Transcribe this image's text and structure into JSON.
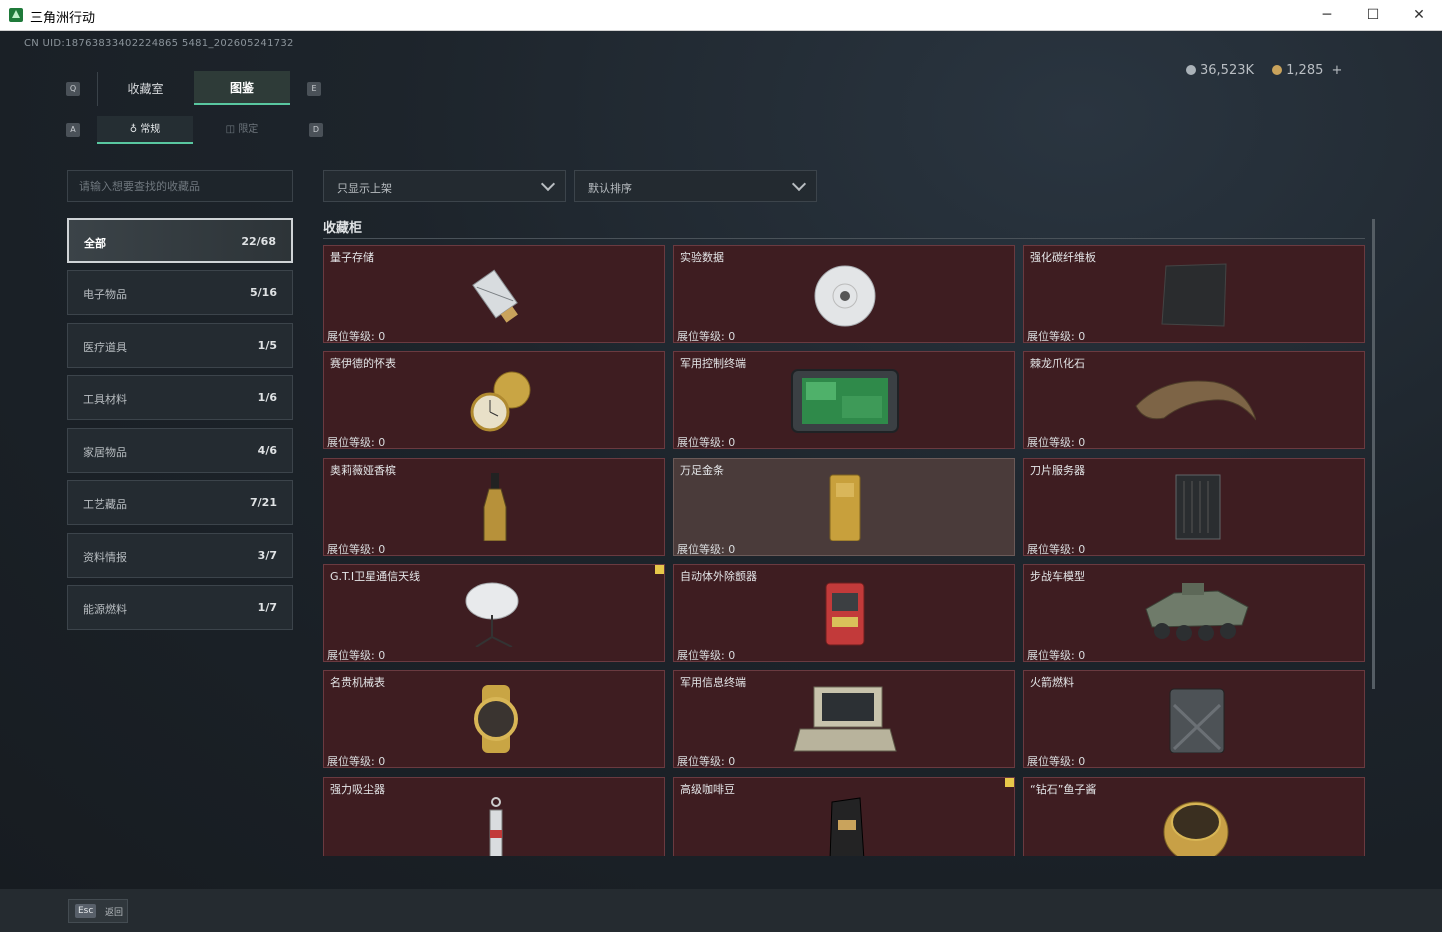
{
  "window": {
    "title": "三角洲行动",
    "min_glyph": "─",
    "max_glyph": "☐",
    "close_glyph": "✕"
  },
  "header": {
    "uid": "CN UID:18763833402224865 5481_202605241732",
    "currency_silver": "36,523K",
    "currency_gold": "1,285",
    "currency_plus": "+"
  },
  "tabs": {
    "key_left": "Q",
    "key_right": "E",
    "collection_label": "收藏室",
    "catalog_label": "图鉴",
    "sub_key_left": "A",
    "sub_key_right": "D",
    "normal_label": "常规",
    "limited_label": "限定"
  },
  "search": {
    "placeholder": "请输入想要查找的收藏品"
  },
  "categories": [
    {
      "label": "全部",
      "count": "22/68"
    },
    {
      "label": "电子物品",
      "count": "5/16"
    },
    {
      "label": "医疗道具",
      "count": "1/5"
    },
    {
      "label": "工具材料",
      "count": "1/6"
    },
    {
      "label": "家居物品",
      "count": "4/6"
    },
    {
      "label": "工艺藏品",
      "count": "7/21"
    },
    {
      "label": "资料情报",
      "count": "3/7"
    },
    {
      "label": "能源燃料",
      "count": "1/7"
    }
  ],
  "filters": {
    "display_filter": "只显示上架",
    "sort": "默认排序"
  },
  "section": {
    "title": "收藏柜"
  },
  "items": [
    {
      "name": "量子存储",
      "level": "展位等级: 0",
      "icon": "usb-drive-icon"
    },
    {
      "name": "实验数据",
      "level": "展位等级: 0",
      "icon": "disc-icon"
    },
    {
      "name": "强化碳纤维板",
      "level": "展位等级: 0",
      "icon": "carbon-plate-icon"
    },
    {
      "name": "赛伊德的怀表",
      "level": "展位等级: 0",
      "icon": "pocket-watch-icon"
    },
    {
      "name": "军用控制终端",
      "level": "展位等级: 0",
      "icon": "tablet-terminal-icon"
    },
    {
      "name": "棘龙爪化石",
      "level": "展位等级: 0",
      "icon": "claw-fossil-icon"
    },
    {
      "name": "奥莉薇娅香槟",
      "level": "展位等级: 0",
      "icon": "champagne-bottle-icon"
    },
    {
      "name": "万足金条",
      "level": "展位等级: 0",
      "icon": "gold-bar-icon"
    },
    {
      "name": "刀片服务器",
      "level": "展位等级: 0",
      "icon": "server-icon"
    },
    {
      "name": "G.T.I卫星通信天线",
      "level": "展位等级: 0",
      "icon": "satellite-dish-icon"
    },
    {
      "name": "自动体外除颤器",
      "level": "展位等级: 0",
      "icon": "defibrillator-icon"
    },
    {
      "name": "步战车模型",
      "level": "展位等级: 0",
      "icon": "armored-vehicle-icon"
    },
    {
      "name": "名贵机械表",
      "level": "展位等级: 0",
      "icon": "wristwatch-icon"
    },
    {
      "name": "军用信息终端",
      "level": "展位等级: 0",
      "icon": "rugged-laptop-icon"
    },
    {
      "name": "火箭燃料",
      "level": "展位等级: 0",
      "icon": "fuel-canister-icon"
    },
    {
      "name": "强力吸尘器",
      "level": "",
      "icon": "vacuum-icon"
    },
    {
      "name": "高级咖啡豆",
      "level": "",
      "icon": "coffee-bag-icon"
    },
    {
      "name": "“钻石”鱼子酱",
      "level": "",
      "icon": "caviar-tin-icon"
    }
  ],
  "footer": {
    "esc_key": "Esc",
    "back_label": "返回"
  }
}
